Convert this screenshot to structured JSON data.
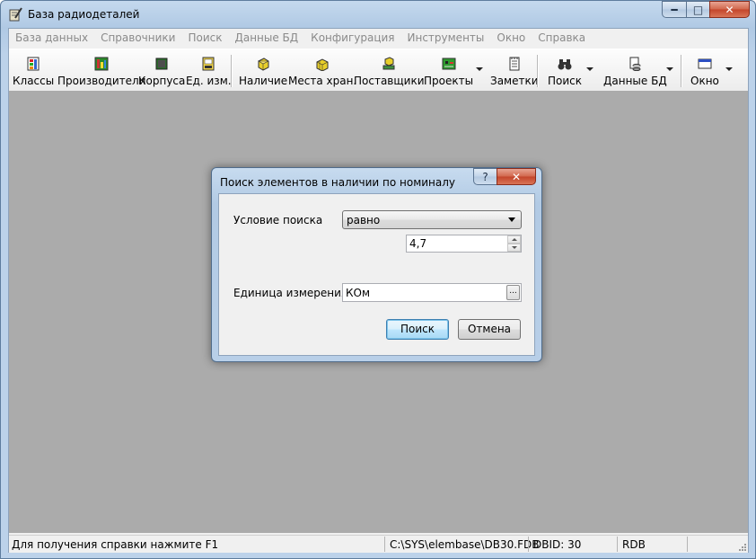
{
  "window": {
    "title": "База радиодеталей"
  },
  "menu": [
    "База данных",
    "Справочники",
    "Поиск",
    "Данные БД",
    "Конфигурация",
    "Инструменты",
    "Окно",
    "Справка"
  ],
  "toolbar": {
    "classes": "Классы",
    "manufacturers": "Производители",
    "packages": "Корпуса",
    "units": "Ед. изм.",
    "stock": "Наличие",
    "storage": "Места хран.",
    "suppliers": "Поставщики",
    "projects": "Проекты",
    "notes": "Заметки",
    "search": "Поиск",
    "db_data": "Данные БД",
    "window": "Окно"
  },
  "status": {
    "hint": "Для получения справки нажмите F1",
    "path": "C:\\SYS\\elembase\\DB30.FDB",
    "dbid": "DBID: 30",
    "mode": "RDB"
  },
  "dialog": {
    "title": "Поиск элементов в наличии по номиналу",
    "condition_label": "Условие поиска",
    "condition_value": "равно",
    "value": "4,7",
    "unit_label": "Единица измерения",
    "unit_value": "КОм",
    "ellipsis": "...",
    "help": "?",
    "search_button": "Поиск",
    "cancel_button": "Отмена"
  },
  "colors": {
    "mdi_background": "#ababab",
    "close_button": "#c3442a"
  }
}
